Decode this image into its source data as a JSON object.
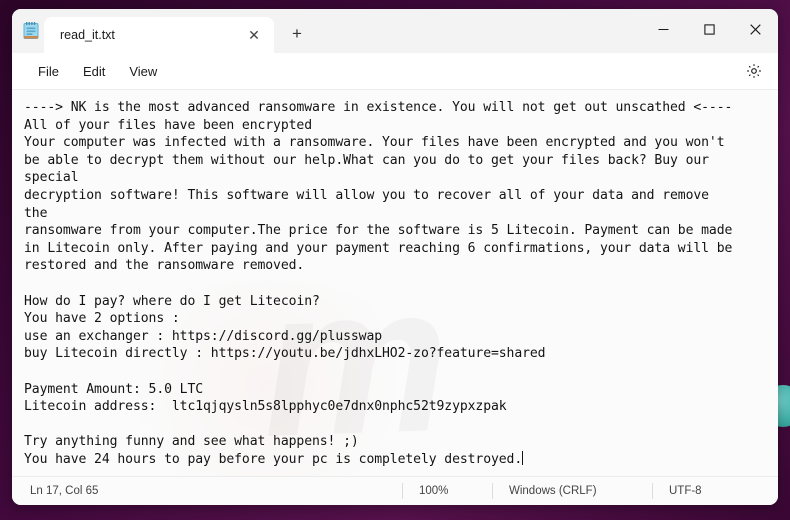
{
  "window": {
    "app_icon": "notepad-icon",
    "tab_label": "read_it.txt",
    "tab_close_glyph": "✕",
    "new_tab_glyph": "+",
    "minimize_glyph": "─",
    "maximize_glyph": "□",
    "close_glyph": "✕"
  },
  "menubar": {
    "items": [
      {
        "label": "File"
      },
      {
        "label": "Edit"
      },
      {
        "label": "View"
      }
    ],
    "settings_icon": "gear-icon"
  },
  "editor": {
    "watermark": "m",
    "content": "----> NK is the most advanced ransomware in existence. You will not get out unscathed <----\nAll of your files have been encrypted\nYour computer was infected with a ransomware. Your files have been encrypted and you won't\nbe able to decrypt them without our help.What can you do to get your files back? Buy our\nspecial\ndecryption software! This software will allow you to recover all of your data and remove\nthe\nransomware from your computer.The price for the software is 5 Litecoin. Payment can be made\nin Litecoin only. After paying and your payment reaching 6 confirmations, your data will be\nrestored and the ransomware removed.\n\nHow do I pay? where do I get Litecoin?\nYou have 2 options :\nuse an exchanger : https://discord.gg/plusswap\nbuy Litecoin directly : https://youtu.be/jdhxLHO2-zo?feature=shared\n\nPayment Amount: 5.0 LTC\nLitecoin address:  ltc1qjqysln5s8lpphyc0e7dnx0nphc52t9zypxzpak\n\nTry anything funny and see what happens! ;)\nYou have 24 hours to pay before your pc is completely destroyed."
  },
  "statusbar": {
    "position": "Ln 17, Col 65",
    "zoom": "100%",
    "line_ending": "Windows (CRLF)",
    "encoding": "UTF-8"
  },
  "colors": {
    "desktop_background": "#41093c",
    "window_background": "#ffffff",
    "editor_background": "#fbfbfb",
    "accent_circle": "#3fb9ae"
  }
}
